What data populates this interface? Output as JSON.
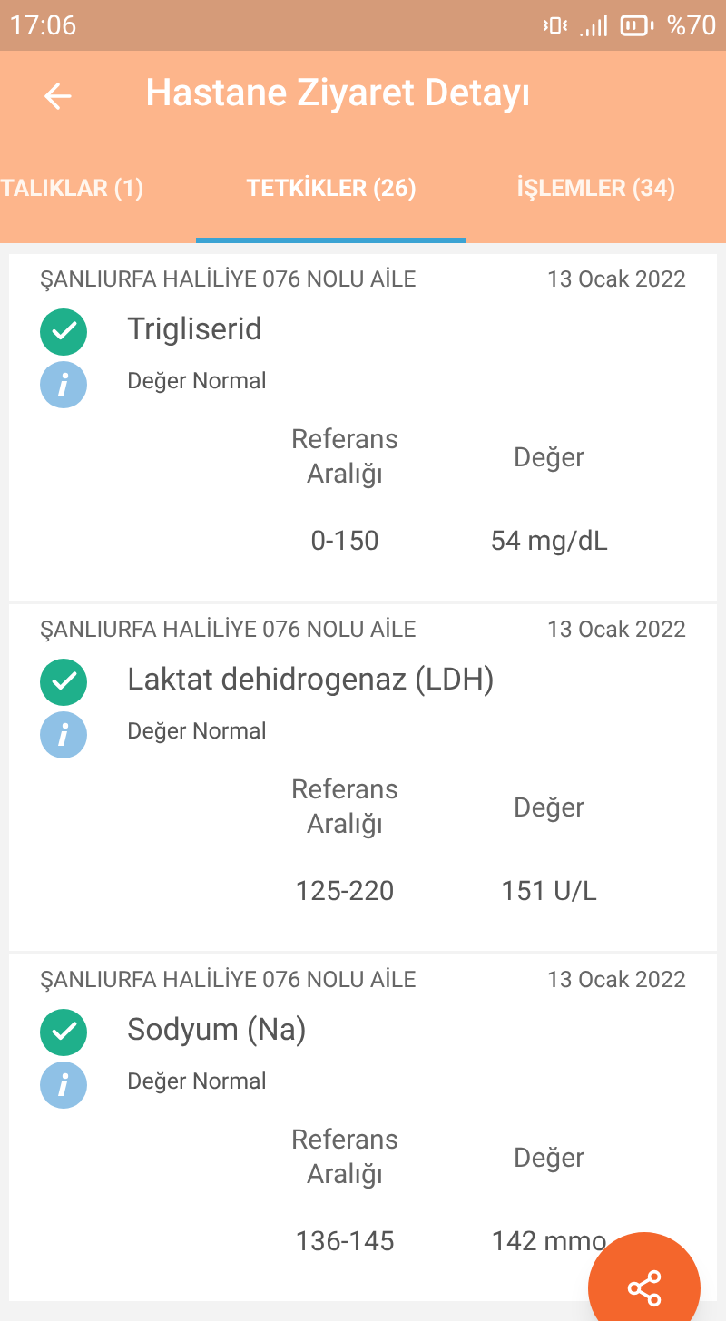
{
  "status_bar": {
    "time": "17:06",
    "battery": "%70"
  },
  "header": {
    "title": "Hastane Ziyaret Detayı"
  },
  "tabs": [
    {
      "label": "TALIKLAR (1)",
      "selected": false
    },
    {
      "label": "TETKİKLER (26)",
      "selected": true
    },
    {
      "label": "İŞLEMLER (34)",
      "selected": false
    }
  ],
  "results": [
    {
      "facility": "ŞANLIURFA HALİLİYE 076 NOLU AİLE",
      "date": "13 Ocak 2022",
      "test": "Trigliserid",
      "note": "Değer Normal",
      "range_label": "Referans Aralığı",
      "value_label": "Değer",
      "range": "0-150",
      "value": "54 mg/dL"
    },
    {
      "facility": "ŞANLIURFA HALİLİYE 076 NOLU AİLE",
      "date": "13 Ocak 2022",
      "test": "Laktat dehidrogenaz (LDH)",
      "note": "Değer Normal",
      "range_label": "Referans Aralığı",
      "value_label": "Değer",
      "range": "125-220",
      "value": "151 U/L"
    },
    {
      "facility": "ŞANLIURFA HALİLİYE 076 NOLU AİLE",
      "date": "13 Ocak 2022",
      "test": "Sodyum (Na)",
      "note": "Değer Normal",
      "range_label": "Referans Aralığı",
      "value_label": "Değer",
      "range": "136-145",
      "value": "142 mmo"
    }
  ]
}
